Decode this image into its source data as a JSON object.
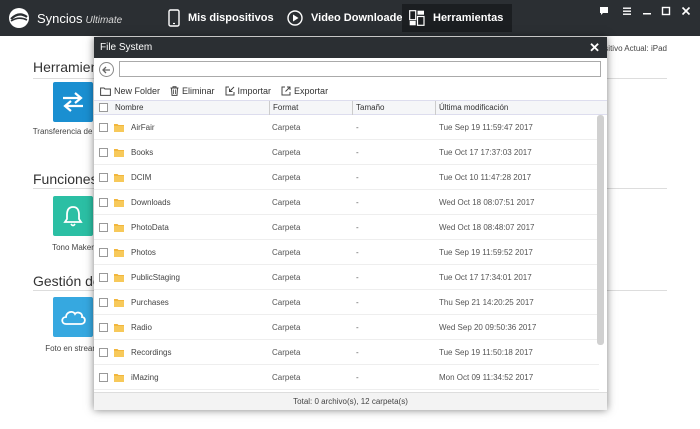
{
  "app": {
    "brand": "Syncios",
    "edition": "Ultimate",
    "nav": {
      "mis": "Mis dispositivos",
      "video": "Video Downloader",
      "herr": "Herramientas"
    }
  },
  "background": {
    "sections": [
      "Herramient",
      "Funciones c",
      "Gestión de"
    ],
    "features": [
      "Transferencia de Móvil",
      "Tono Maker",
      "Foto en streami"
    ],
    "device_note": "positivo Actual: iPad"
  },
  "dialog": {
    "title": "File System",
    "path_value": "",
    "toolbar": {
      "new_folder": "New Folder",
      "delete": "Eliminar",
      "import": "Importar",
      "export": "Exportar"
    },
    "columns": {
      "name": "Nombre",
      "format": "Format",
      "size": "Tamaño",
      "modified": "Última modificación"
    },
    "rows": [
      {
        "name": "AirFair",
        "format": "Carpeta",
        "size": "-",
        "modified": "Tue Sep 19 11:59:47 2017"
      },
      {
        "name": "Books",
        "format": "Carpeta",
        "size": "-",
        "modified": "Tue Oct 17 17:37:03 2017"
      },
      {
        "name": "DCIM",
        "format": "Carpeta",
        "size": "-",
        "modified": "Tue Oct 10 11:47:28 2017"
      },
      {
        "name": "Downloads",
        "format": "Carpeta",
        "size": "-",
        "modified": "Wed Oct 18 08:07:51 2017"
      },
      {
        "name": "PhotoData",
        "format": "Carpeta",
        "size": "-",
        "modified": "Wed Oct 18 08:48:07 2017"
      },
      {
        "name": "Photos",
        "format": "Carpeta",
        "size": "-",
        "modified": "Tue Sep 19 11:59:52 2017"
      },
      {
        "name": "PublicStaging",
        "format": "Carpeta",
        "size": "-",
        "modified": "Tue Oct 17 17:34:01 2017"
      },
      {
        "name": "Purchases",
        "format": "Carpeta",
        "size": "-",
        "modified": "Thu Sep 21 14:20:25 2017"
      },
      {
        "name": "Radio",
        "format": "Carpeta",
        "size": "-",
        "modified": "Wed Sep 20 09:50:36 2017"
      },
      {
        "name": "Recordings",
        "format": "Carpeta",
        "size": "-",
        "modified": "Tue Sep 19 11:50:18 2017"
      },
      {
        "name": "iMazing",
        "format": "Carpeta",
        "size": "-",
        "modified": "Mon Oct 09 11:34:52 2017"
      }
    ],
    "status": "Total: 0 archivo(s), 12 carpeta(s)"
  },
  "colors": {
    "topbar": "#2b2f33",
    "accent_blue": "#1a8fd1",
    "folder": "#f2b63c"
  }
}
